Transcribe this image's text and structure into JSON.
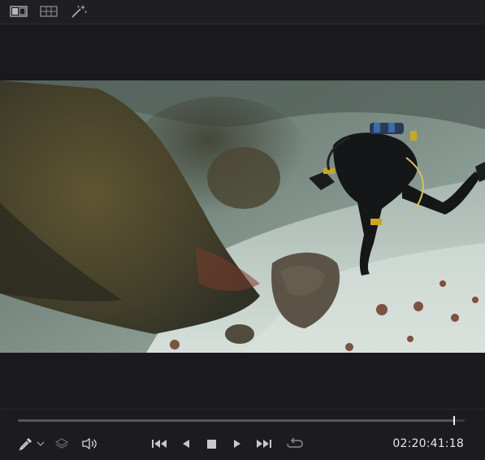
{
  "toolbar": {
    "icons": [
      "single-viewer-icon",
      "split-viewer-icon",
      "magic-wand-icon"
    ]
  },
  "video": {
    "description_colors": {
      "water": "#7f918a",
      "sand": "#c9d3cc",
      "rock": "#4b4630",
      "diver": "#141618"
    }
  },
  "transport": {
    "progress": 0.976,
    "timecode": "02:20:41:18",
    "icons": [
      "eyedropper-icon",
      "chevron-down-icon",
      "layers-icon",
      "speaker-icon",
      "skip-back-icon",
      "step-back-icon",
      "stop-icon",
      "play-icon",
      "skip-forward-icon",
      "loop-icon"
    ]
  },
  "colors": {
    "background": "#1c1c20",
    "icon": "#c8c8cc",
    "icon_dim": "#6a6a70",
    "playhead": "#f2f2f2"
  }
}
